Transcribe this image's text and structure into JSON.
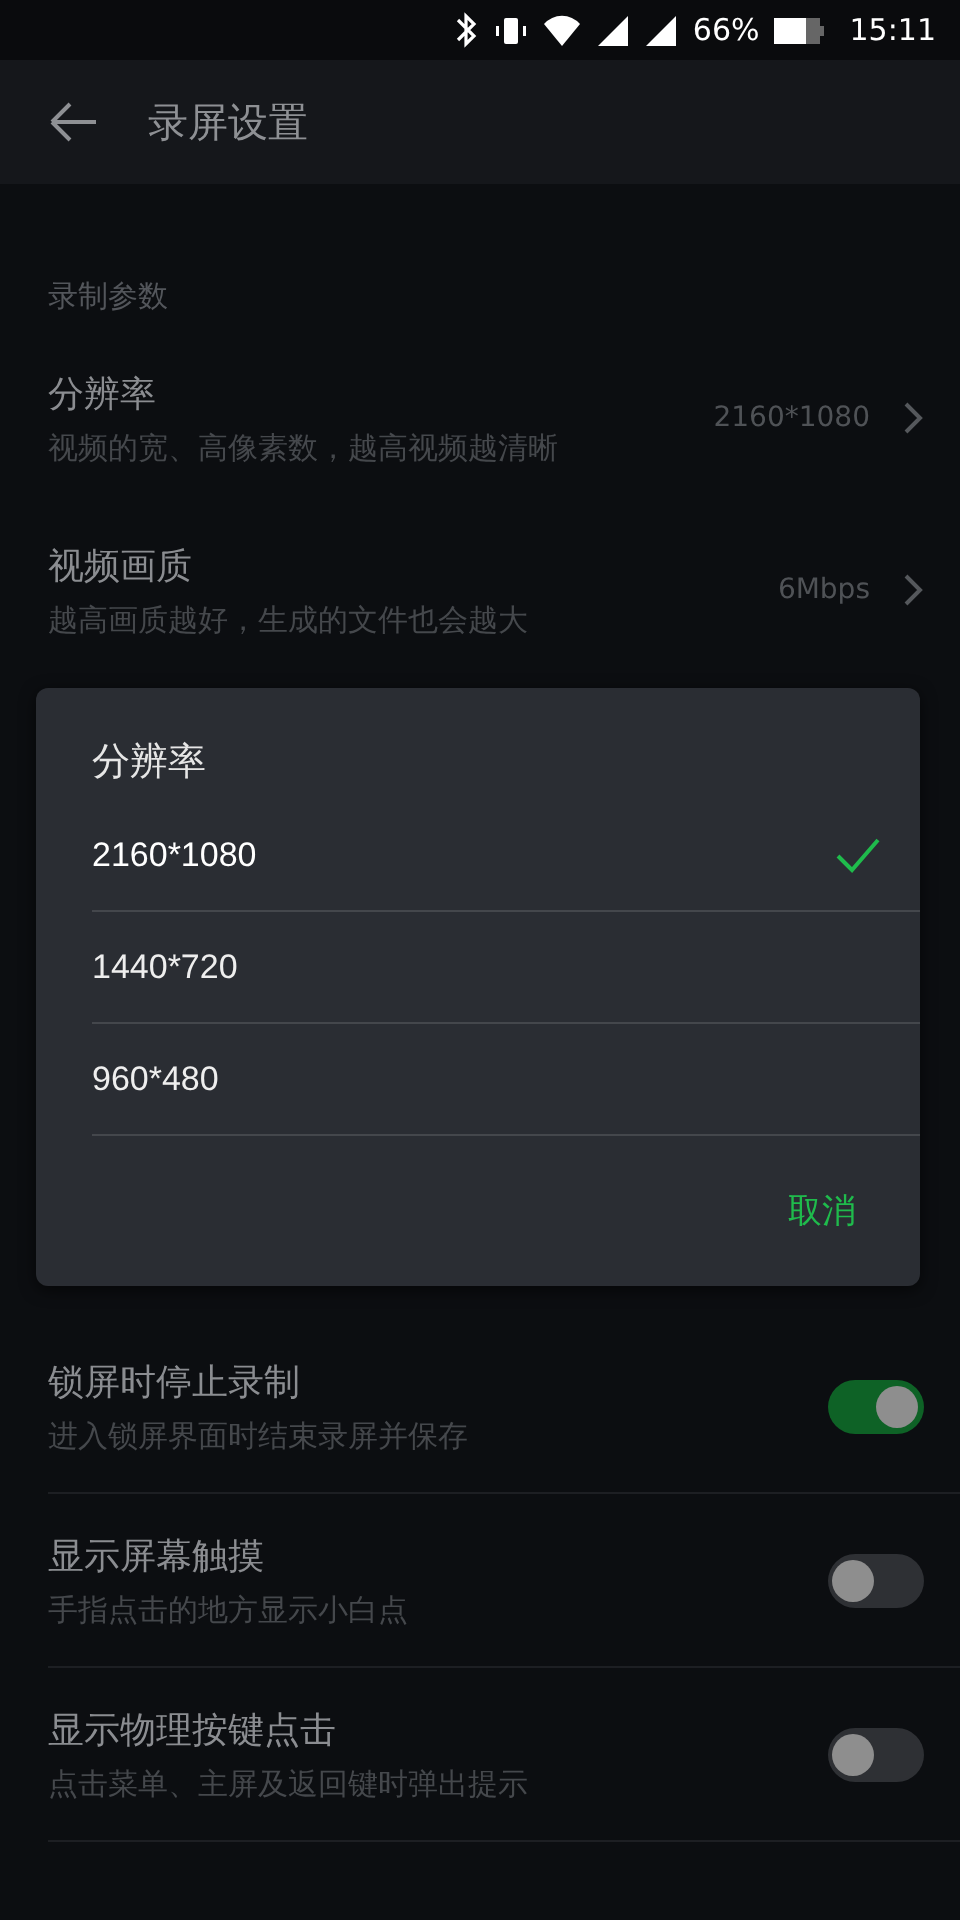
{
  "status_bar": {
    "battery": "66%",
    "time": "15:11"
  },
  "app_bar": {
    "title": "录屏设置"
  },
  "sections": [
    {
      "header": "录制参数",
      "items": [
        {
          "kind": "nav",
          "title": "分辨率",
          "subtitle": "视频的宽、高像素数，越高视频越清晰",
          "value": "2160*1080"
        },
        {
          "kind": "nav",
          "title": "视频画质",
          "subtitle": "越高画质越好，生成的文件也会越大",
          "value": "6Mbps"
        }
      ]
    },
    {
      "items": [
        {
          "kind": "toggle",
          "title": "锁屏时停止录制",
          "subtitle": "进入锁屏界面时结束录屏并保存",
          "on": true
        },
        {
          "kind": "toggle",
          "title": "显示屏幕触摸",
          "subtitle": "手指点击的地方显示小白点",
          "on": false
        },
        {
          "kind": "toggle",
          "title": "显示物理按键点击",
          "subtitle": "点击菜单、主屏及返回键时弹出提示",
          "on": false
        }
      ]
    }
  ],
  "dialog": {
    "title": "分辨率",
    "options": [
      {
        "label": "2160*1080",
        "selected": true
      },
      {
        "label": "1440*720",
        "selected": false
      },
      {
        "label": "960*480",
        "selected": false
      }
    ],
    "cancel": "取消"
  }
}
